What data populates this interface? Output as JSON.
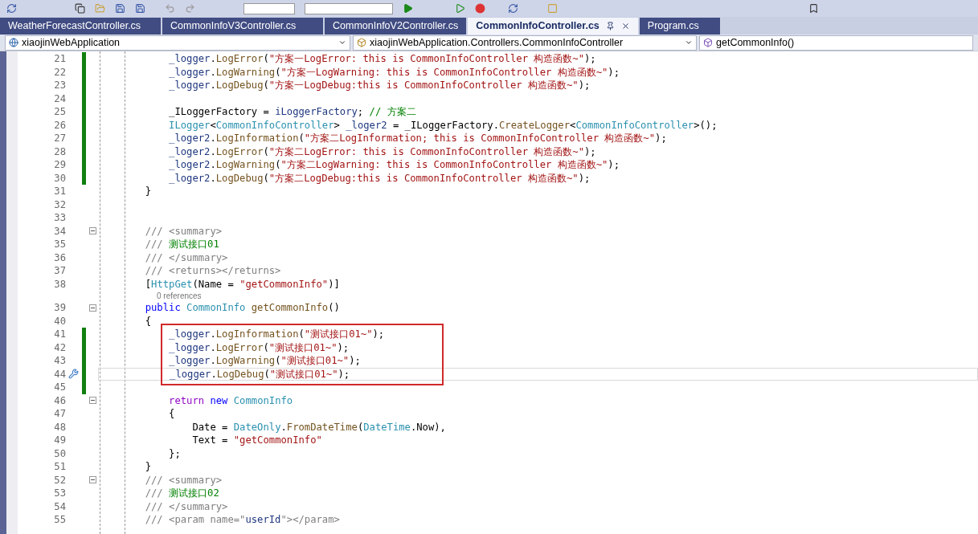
{
  "tabs": [
    {
      "label": "WeatherForecastController.cs",
      "selected": false
    },
    {
      "label": "CommonInfoV3Controller.cs",
      "selected": false
    },
    {
      "label": "CommonInfoV2Controller.cs",
      "selected": false
    },
    {
      "label": "CommonInfoController.cs",
      "selected": true
    },
    {
      "label": "Program.cs",
      "selected": false
    }
  ],
  "navigation": {
    "project": "xiaojinWebApplication",
    "type": "xiaojinWebApplication.Controllers.CommonInfoController",
    "member": "getCommonInfo()"
  },
  "lines": [
    {
      "number": "21",
      "changed": true,
      "tokens": [
        {
          "text": "            _logger",
          "kind": "field"
        },
        {
          "text": ".",
          "kind": "plain"
        },
        {
          "text": "LogError",
          "kind": "method"
        },
        {
          "text": "(",
          "kind": "plain"
        },
        {
          "text": "\"方案一LogError: this is CommonInfoController 构造函数~\"",
          "kind": "string"
        },
        {
          "text": ");",
          "kind": "plain"
        }
      ]
    },
    {
      "number": "22",
      "changed": true,
      "tokens": [
        {
          "text": "            _logger",
          "kind": "field"
        },
        {
          "text": ".",
          "kind": "plain"
        },
        {
          "text": "LogWarning",
          "kind": "method"
        },
        {
          "text": "(",
          "kind": "plain"
        },
        {
          "text": "\"方案一LogWarning: this is CommonInfoController 构造函数~\"",
          "kind": "string"
        },
        {
          "text": ");",
          "kind": "plain"
        }
      ]
    },
    {
      "number": "23",
      "changed": true,
      "tokens": [
        {
          "text": "            _logger",
          "kind": "field"
        },
        {
          "text": ".",
          "kind": "plain"
        },
        {
          "text": "LogDebug",
          "kind": "method"
        },
        {
          "text": "(",
          "kind": "plain"
        },
        {
          "text": "\"方案一LogDebug:this is CommonInfoController 构造函数~\"",
          "kind": "string"
        },
        {
          "text": ");",
          "kind": "plain"
        }
      ]
    },
    {
      "number": "24",
      "changed": true
    },
    {
      "number": "25",
      "changed": true,
      "tokens": [
        {
          "text": "            _ILoggerFactory = ",
          "kind": "plain"
        },
        {
          "text": "iLoggerFactory",
          "kind": "field"
        },
        {
          "text": "; ",
          "kind": "plain"
        },
        {
          "text": "// 方案二",
          "kind": "comment"
        }
      ]
    },
    {
      "number": "26",
      "changed": true,
      "tokens": [
        {
          "text": "            ILogger",
          "kind": "type"
        },
        {
          "text": "<",
          "kind": "plain"
        },
        {
          "text": "CommonInfoController",
          "kind": "type"
        },
        {
          "text": "> ",
          "kind": "plain"
        },
        {
          "text": "_loger2",
          "kind": "field"
        },
        {
          "text": " = _ILoggerFactory.",
          "kind": "plain"
        },
        {
          "text": "CreateLogger",
          "kind": "method"
        },
        {
          "text": "<",
          "kind": "plain"
        },
        {
          "text": "CommonInfoController",
          "kind": "type"
        },
        {
          "text": ">();",
          "kind": "plain"
        }
      ]
    },
    {
      "number": "27",
      "changed": true,
      "tokens": [
        {
          "text": "            _loger2",
          "kind": "field"
        },
        {
          "text": ".",
          "kind": "plain"
        },
        {
          "text": "LogInformation",
          "kind": "method"
        },
        {
          "text": "(",
          "kind": "plain"
        },
        {
          "text": "\"方案二LogInformation; this is CommonInfoController 构造函数~\"",
          "kind": "string"
        },
        {
          "text": ");",
          "kind": "plain"
        }
      ]
    },
    {
      "number": "28",
      "changed": true,
      "tokens": [
        {
          "text": "            _loger2",
          "kind": "field"
        },
        {
          "text": ".",
          "kind": "plain"
        },
        {
          "text": "LogError",
          "kind": "method"
        },
        {
          "text": "(",
          "kind": "plain"
        },
        {
          "text": "\"方案二LogError: this is CommonInfoController 构造函数~\"",
          "kind": "string"
        },
        {
          "text": ");",
          "kind": "plain"
        }
      ]
    },
    {
      "number": "29",
      "changed": true,
      "tokens": [
        {
          "text": "            _loger2",
          "kind": "field"
        },
        {
          "text": ".",
          "kind": "plain"
        },
        {
          "text": "LogWarning",
          "kind": "method"
        },
        {
          "text": "(",
          "kind": "plain"
        },
        {
          "text": "\"方案二LogWarning: this is CommonInfoController 构造函数~\"",
          "kind": "string"
        },
        {
          "text": ");",
          "kind": "plain"
        }
      ]
    },
    {
      "number": "30",
      "changed": true,
      "tokens": [
        {
          "text": "            _loger2",
          "kind": "field"
        },
        {
          "text": ".",
          "kind": "plain"
        },
        {
          "text": "LogDebug",
          "kind": "method"
        },
        {
          "text": "(",
          "kind": "plain"
        },
        {
          "text": "\"方案二LogDebug:this is CommonInfoController 构造函数~\"",
          "kind": "string"
        },
        {
          "text": ");",
          "kind": "plain"
        }
      ]
    },
    {
      "number": "31",
      "changed": false,
      "tokens": [
        {
          "text": "        }",
          "kind": "plain"
        }
      ]
    },
    {
      "number": "32",
      "changed": false
    },
    {
      "number": "33",
      "changed": false
    },
    {
      "number": "34",
      "changed": false,
      "foldable": true,
      "tokens": [
        {
          "text": "        /// <summary>",
          "kind": "doc"
        }
      ]
    },
    {
      "number": "35",
      "changed": false,
      "tokens": [
        {
          "text": "        /// ",
          "kind": "doc"
        },
        {
          "text": "测试接口01",
          "kind": "comment"
        }
      ]
    },
    {
      "number": "36",
      "changed": false,
      "tokens": [
        {
          "text": "        /// </summary>",
          "kind": "doc"
        }
      ]
    },
    {
      "number": "37",
      "changed": false,
      "tokens": [
        {
          "text": "        /// <returns></returns>",
          "kind": "doc"
        }
      ]
    },
    {
      "number": "38",
      "changed": false,
      "tokens": [
        {
          "text": "        [",
          "kind": "plain"
        },
        {
          "text": "HttpGet",
          "kind": "type"
        },
        {
          "text": "(Name = ",
          "kind": "plain"
        },
        {
          "text": "\"getCommonInfo\"",
          "kind": "string"
        },
        {
          "text": ")]",
          "kind": "plain"
        }
      ]
    },
    {
      "number": "39",
      "changed": false,
      "foldable": true,
      "codelens": "0 references",
      "tokens": [
        {
          "text": "        public ",
          "kind": "keyword"
        },
        {
          "text": "CommonInfo ",
          "kind": "type"
        },
        {
          "text": "getCommonInfo",
          "kind": "method"
        },
        {
          "text": "()",
          "kind": "plain"
        }
      ]
    },
    {
      "number": "40",
      "changed": false,
      "tokens": [
        {
          "text": "        {",
          "kind": "plain"
        }
      ]
    },
    {
      "number": "41",
      "changed": true,
      "boxed": true,
      "tokens": [
        {
          "text": "            _logger",
          "kind": "field"
        },
        {
          "text": ".",
          "kind": "plain"
        },
        {
          "text": "LogInformation",
          "kind": "method"
        },
        {
          "text": "(",
          "kind": "plain"
        },
        {
          "text": "\"测试接口01~\"",
          "kind": "string"
        },
        {
          "text": ");",
          "kind": "plain"
        }
      ]
    },
    {
      "number": "42",
      "changed": true,
      "boxed": true,
      "tokens": [
        {
          "text": "            _logger",
          "kind": "field"
        },
        {
          "text": ".",
          "kind": "plain"
        },
        {
          "text": "LogError",
          "kind": "method"
        },
        {
          "text": "(",
          "kind": "plain"
        },
        {
          "text": "\"测试接口01~\"",
          "kind": "string"
        },
        {
          "text": ");",
          "kind": "plain"
        }
      ]
    },
    {
      "number": "43",
      "changed": true,
      "boxed": true,
      "tokens": [
        {
          "text": "            _logger",
          "kind": "field"
        },
        {
          "text": ".",
          "kind": "plain"
        },
        {
          "text": "LogWarning",
          "kind": "method"
        },
        {
          "text": "(",
          "kind": "plain"
        },
        {
          "text": "\"测试接口01~\"",
          "kind": "string"
        },
        {
          "text": ");",
          "kind": "plain"
        }
      ]
    },
    {
      "number": "44",
      "changed": true,
      "boxed": true,
      "current": true,
      "tokens": [
        {
          "text": "            _logger",
          "kind": "field"
        },
        {
          "text": ".",
          "kind": "plain"
        },
        {
          "text": "LogDebug",
          "kind": "method"
        },
        {
          "text": "(",
          "kind": "plain"
        },
        {
          "text": "\"测试接口01~\"",
          "kind": "string"
        },
        {
          "text": ");",
          "kind": "plain"
        }
      ]
    },
    {
      "number": "45",
      "changed": true
    },
    {
      "number": "46",
      "changed": false,
      "foldable": true,
      "tokens": [
        {
          "text": "            return ",
          "kind": "control"
        },
        {
          "text": "new ",
          "kind": "keyword"
        },
        {
          "text": "CommonInfo",
          "kind": "type"
        }
      ]
    },
    {
      "number": "47",
      "changed": false,
      "tokens": [
        {
          "text": "            {",
          "kind": "plain"
        }
      ]
    },
    {
      "number": "48",
      "changed": false,
      "tokens": [
        {
          "text": "                Date = ",
          "kind": "plain"
        },
        {
          "text": "DateOnly",
          "kind": "type"
        },
        {
          "text": ".",
          "kind": "plain"
        },
        {
          "text": "FromDateTime",
          "kind": "method"
        },
        {
          "text": "(",
          "kind": "plain"
        },
        {
          "text": "DateTime",
          "kind": "type"
        },
        {
          "text": ".Now),",
          "kind": "plain"
        }
      ]
    },
    {
      "number": "49",
      "changed": false,
      "tokens": [
        {
          "text": "                Text = ",
          "kind": "plain"
        },
        {
          "text": "\"getCommonInfo\"",
          "kind": "string"
        }
      ]
    },
    {
      "number": "50",
      "changed": false,
      "tokens": [
        {
          "text": "            };",
          "kind": "plain"
        }
      ]
    },
    {
      "number": "51",
      "changed": false,
      "tokens": [
        {
          "text": "        }",
          "kind": "plain"
        }
      ]
    },
    {
      "number": "52",
      "changed": false,
      "foldable": true,
      "tokens": [
        {
          "text": "        /// <summary>",
          "kind": "doc"
        }
      ]
    },
    {
      "number": "53",
      "changed": false,
      "tokens": [
        {
          "text": "        /// ",
          "kind": "doc"
        },
        {
          "text": "测试接口02",
          "kind": "comment"
        }
      ]
    },
    {
      "number": "54",
      "changed": false,
      "tokens": [
        {
          "text": "        /// </summary>",
          "kind": "doc"
        }
      ]
    },
    {
      "number": "55",
      "changed": false,
      "tokens": [
        {
          "text": "        /// <param name=\"",
          "kind": "doc"
        },
        {
          "text": "userId",
          "kind": "field"
        },
        {
          "text": "\"></param>",
          "kind": "doc"
        }
      ]
    }
  ]
}
